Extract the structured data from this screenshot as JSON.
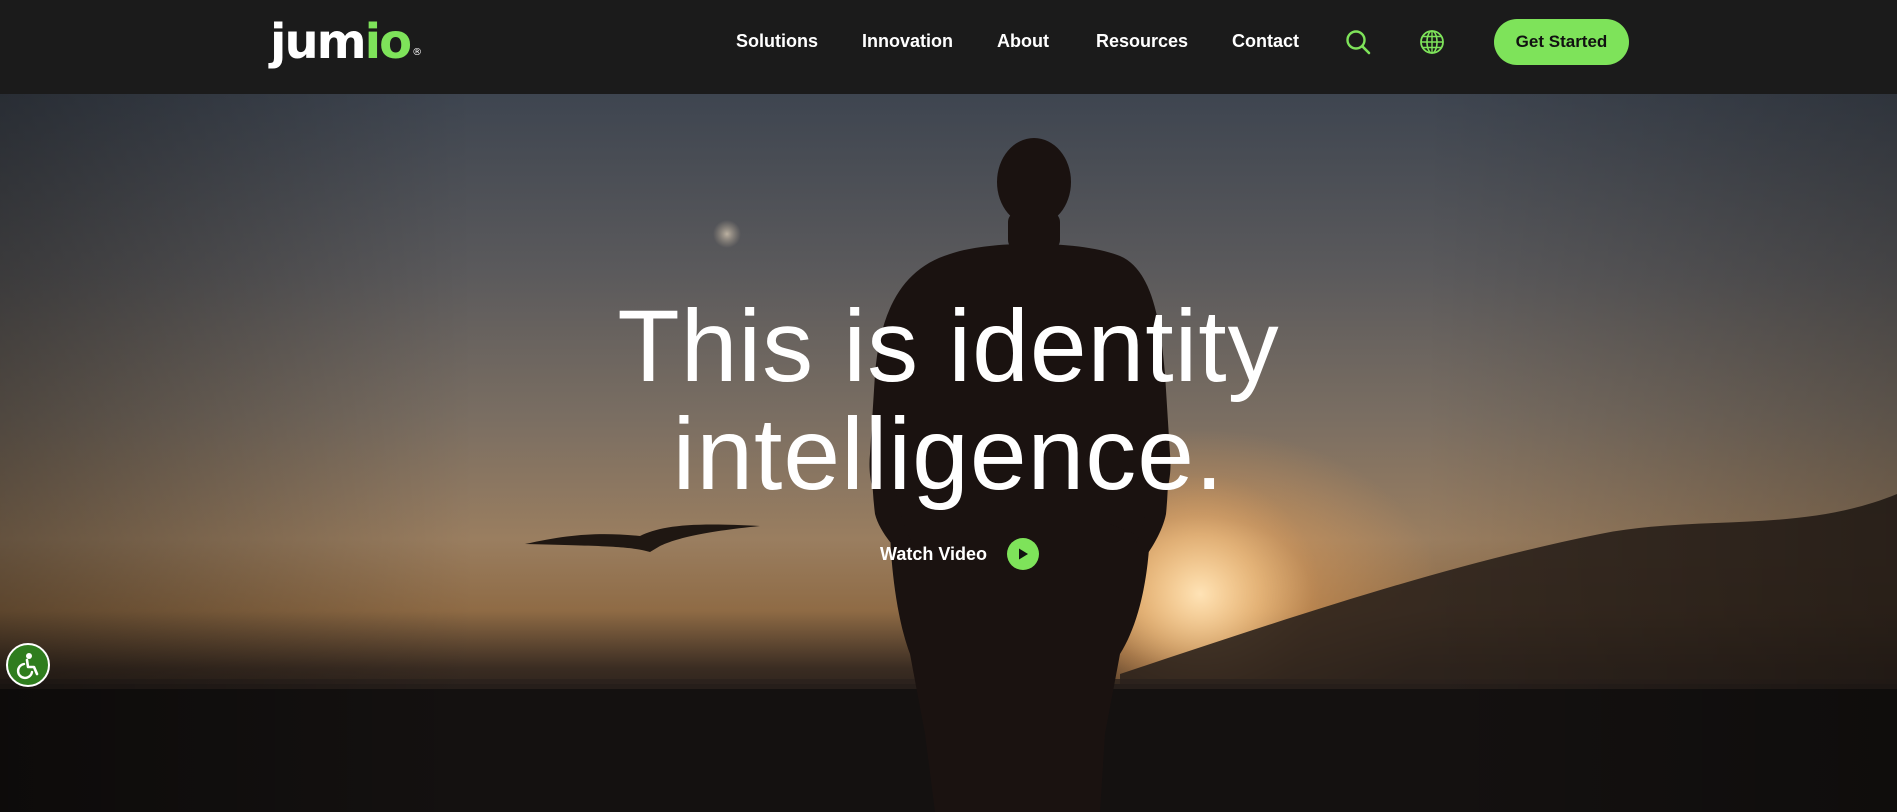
{
  "header": {
    "logo": {
      "main": "jum",
      "accent": "io",
      "mark": "®"
    },
    "nav": [
      "Solutions",
      "Innovation",
      "About",
      "Resources",
      "Contact"
    ],
    "search_icon": "search-icon",
    "language_icon": "globe-icon",
    "cta_label": "Get Started"
  },
  "hero": {
    "headline_line1": "This is identity",
    "headline_line2": "intelligence.",
    "watch_label": "Watch Video",
    "play_icon": "play-icon"
  },
  "accessibility": {
    "icon": "accessibility-icon"
  },
  "colors": {
    "accent": "#7ee35a",
    "header_bg": "#1b1b1b",
    "accessibility_bg": "#2f7d1e"
  }
}
